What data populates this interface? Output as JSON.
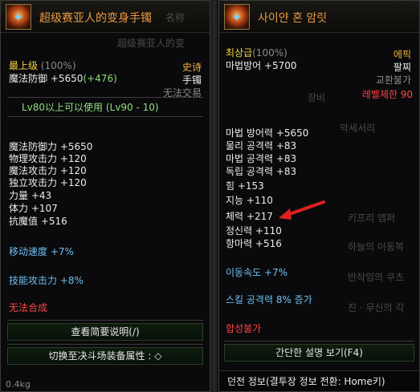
{
  "left": {
    "title": "超级赛亚人的变身手镯",
    "ghost_header": "名称",
    "ghost_header2": "超级赛亚人的变",
    "grade_label": "最上级",
    "grade_pct": "(100%)",
    "rarity": "史诗",
    "defense_label": "魔法防御",
    "defense_value": "+5650",
    "defense_bonus": "(+476)",
    "slot": "手镯",
    "trade": "无法交易",
    "level_req": "Lv80以上可以使用 (Lv90 - 10)",
    "stats": [
      {
        "label": "魔法防御力",
        "value": "+5650"
      },
      {
        "label": "物理攻击力",
        "value": "+120"
      },
      {
        "label": "魔法攻击力",
        "value": "+120"
      },
      {
        "label": "独立攻击力",
        "value": "+120"
      },
      {
        "label": "力量",
        "value": "+43"
      },
      {
        "label": "体力",
        "value": "+107"
      },
      {
        "label": "抗魔值",
        "value": "+516"
      }
    ],
    "move_speed": "移动速度 +7%",
    "skill_attack": "技能攻击力 +8%",
    "no_synth": "无法合成",
    "btn_desc": "查看简要说明(/)",
    "footer": "切换至决斗场装备属性 : ◇",
    "weight": "0.4kg"
  },
  "right": {
    "title": "사이얀 혼 암릿",
    "grade_label": "최상급",
    "grade_pct": "(100%)",
    "rarity": "에픽",
    "defense": "마법방어 +5700",
    "slot": "팔찌",
    "trade": "교환불가",
    "level_req": "레벨제한 90",
    "ghost_equip": "장비",
    "ghost_acc": "악세서리",
    "stats": [
      "마법 방어력 +5650",
      "물리 공격력 +83",
      "마법 공격력 +83",
      "독립 공격력 +83",
      "힘 +153",
      "지능 +110",
      "체력 +217",
      "정신력 +110",
      "항마력 +516"
    ],
    "move_speed": "이동속도 +7%",
    "skill_attack": "스킬 공격력 8% 증가",
    "no_synth": "합성불가",
    "btn_desc": "간단한 설명 보기(F4)",
    "footer": "던전 정보(결투장 정보 전환: Home키)",
    "ghost_side": [
      "키프리 엠퍼",
      "하늘의 이동복",
      "반작임의 쿠츠",
      "진 · 무신의 각"
    ]
  },
  "colors": {
    "title": "#e89a44",
    "grade": "#f5d23a",
    "rarity": "#f0b040",
    "level": "#8ee07a",
    "buff": "#6ec0f0",
    "warn": "#ff4444",
    "arrow": "#e02020"
  }
}
